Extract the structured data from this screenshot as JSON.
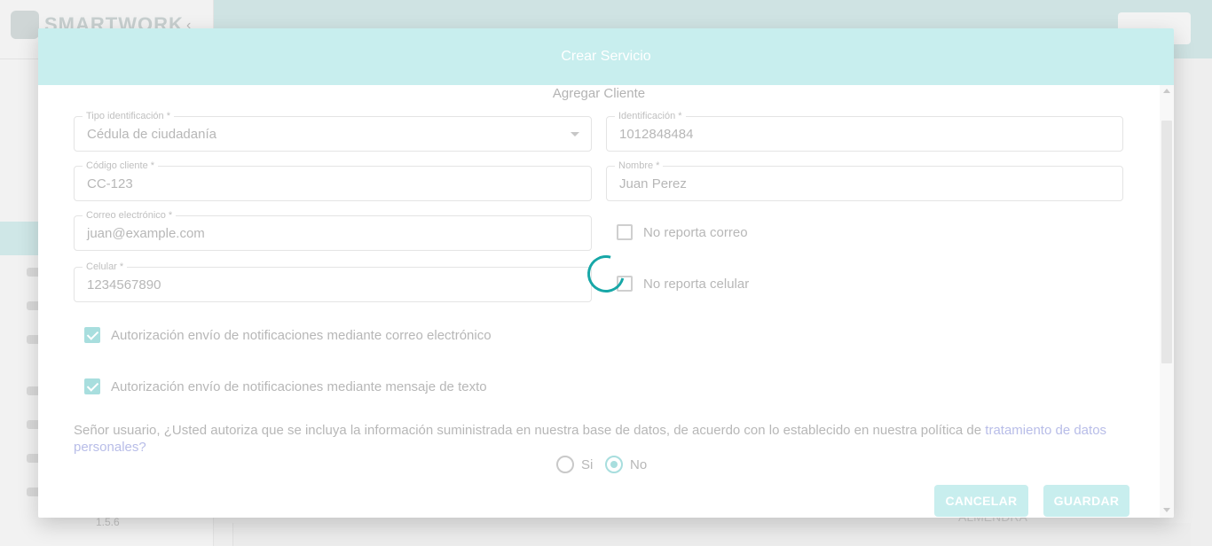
{
  "app": {
    "logo_text": "SMARTWORK",
    "version": "1.5.6",
    "bg_content_text": "ALMENDRA"
  },
  "modal": {
    "title": "Crear Servicio",
    "section_title": "Agregar Cliente",
    "fields": {
      "tipo_identificacion": {
        "label": "Tipo identificación *",
        "value": "Cédula de ciudadanía"
      },
      "identificacion": {
        "label": "Identificación *",
        "value": "1012848484"
      },
      "codigo_cliente": {
        "label": "Código cliente *",
        "value": "CC-123"
      },
      "nombre": {
        "label": "Nombre *",
        "value": "Juan Perez"
      },
      "correo": {
        "label": "Correo electrónico *",
        "value": "juan@example.com"
      },
      "celular": {
        "label": "Celular *",
        "value": "1234567890"
      }
    },
    "checkboxes": {
      "no_reporta_correo": {
        "label": "No reporta correo",
        "checked": false
      },
      "no_reporta_celular": {
        "label": "No reporta celular",
        "checked": false
      },
      "auth_email": {
        "label": "Autorización envío de notificaciones mediante correo electrónico",
        "checked": true
      },
      "auth_sms": {
        "label": "Autorización envío de notificaciones mediante mensaje de texto",
        "checked": true
      }
    },
    "consent": {
      "text": "Señor usuario, ¿Usted autoriza que se incluya la información suministrada en nuestra base de datos, de acuerdo con lo establecido en nuestra política de ",
      "link": "tratamiento de datos personales?"
    },
    "radio": {
      "options": [
        "Si",
        "No"
      ],
      "selected": "No"
    },
    "buttons": {
      "cancel": "CANCELAR",
      "save": "GUARDAR"
    }
  },
  "colors": {
    "accent": "#c8eeee",
    "spinner": "#17a7a7",
    "link": "#b8bde8"
  },
  "status": {
    "loading": true
  }
}
